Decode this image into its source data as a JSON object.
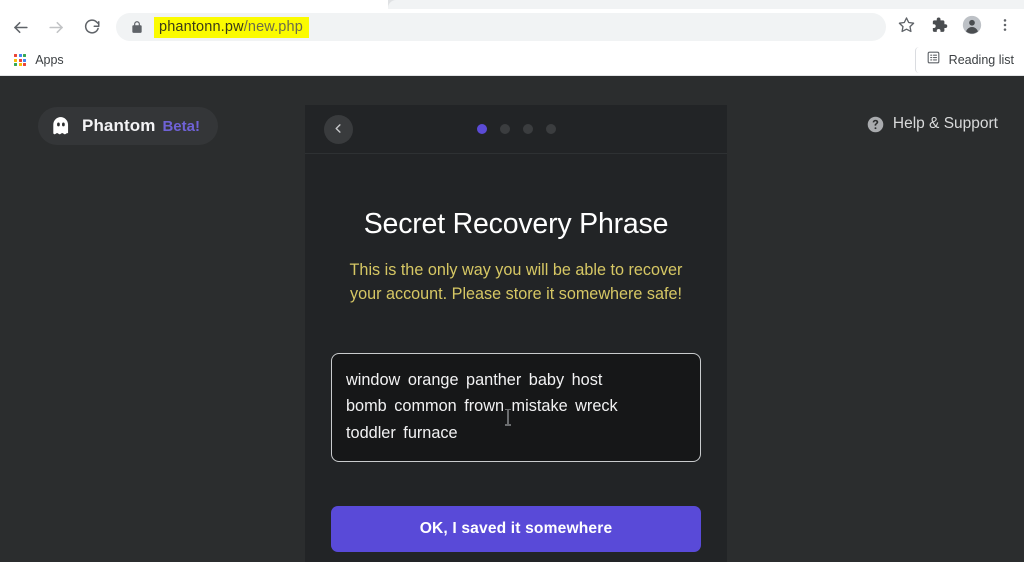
{
  "browser": {
    "back_icon": "back-arrow-icon",
    "forward_icon": "forward-arrow-icon",
    "reload_icon": "reload-icon",
    "lock_icon": "lock-icon",
    "url_domain": "phantonn.pw",
    "url_path": "/new.php",
    "url_full": "phantonn.pw/new.php",
    "url_highlight_color": "#fbfb00",
    "bookmark_icon": "star-icon",
    "extensions_icon": "puzzle-piece-icon",
    "profile_icon": "account-avatar-icon",
    "menu_icon": "three-dot-menu-icon",
    "apps_label": "Apps",
    "apps_icon": "apps-grid-icon",
    "reading_list_label": "Reading list",
    "reading_list_icon": "reading-list-icon"
  },
  "page": {
    "background_color": "#2b2d2e",
    "brand": {
      "icon": "ghost-icon",
      "name": "Phantom",
      "beta": "Beta!",
      "beta_color": "#6f62d6"
    },
    "help": {
      "icon": "question-mark-circle-icon",
      "label": "Help & Support"
    }
  },
  "modal": {
    "back_icon": "chevron-left-icon",
    "pagination": {
      "total": 4,
      "active_index": 0,
      "active_color": "#5b4bd6",
      "inactive_color": "#3b3d3f"
    },
    "title": "Secret Recovery Phrase",
    "warning": "This is the only way you will be able to recover your account. Please store it somewhere safe!",
    "warning_color": "#d6c764",
    "seed_line_1": "window  orange  panther  baby  host",
    "seed_line_2": "bomb  common  frown  mistake  wreck",
    "seed_line_3": "toddler  furnace",
    "seed_words": [
      "window",
      "orange",
      "panther",
      "baby",
      "host",
      "bomb",
      "common",
      "frown",
      "mistake",
      "wreck",
      "toddler",
      "furnace"
    ],
    "cta_label": "OK, I saved it somewhere",
    "cta_color": "#594ad8"
  }
}
